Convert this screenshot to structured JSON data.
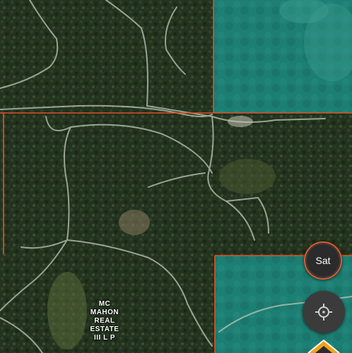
{
  "map": {
    "view": "satellite",
    "boundary_color": "#e0522a",
    "water_color": "#1b7f74"
  },
  "parcel_label": {
    "lines": [
      "MC",
      "MAHON",
      "REAL",
      "ESTATE",
      "III L P"
    ]
  },
  "controls": {
    "sat_label": "Sat",
    "recenter_icon": "crosshair-target-icon",
    "marker_icon": "navigation-marker-icon"
  }
}
